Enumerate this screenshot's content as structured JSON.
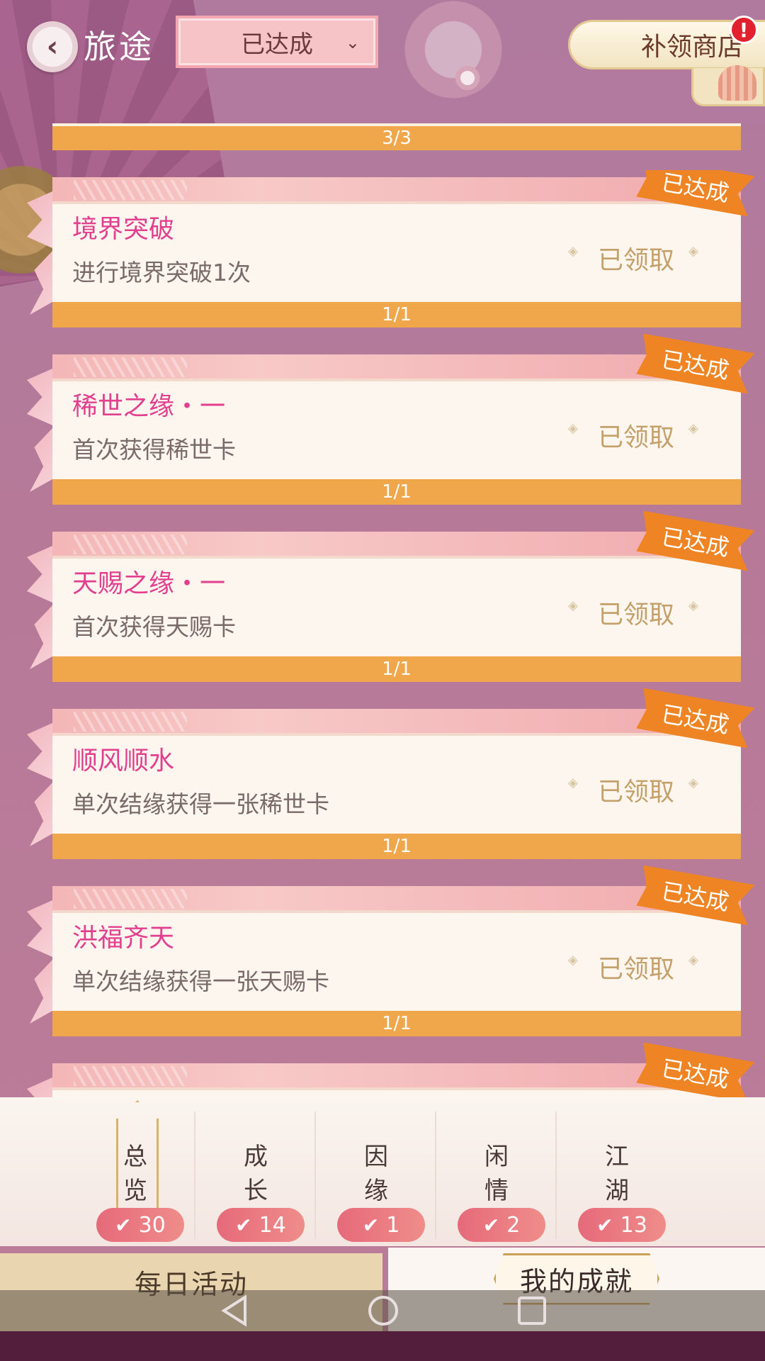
{
  "header": {
    "title": "旅途",
    "filter_selected": "已达成",
    "shop_label": "补领商店",
    "shop_alert": "!"
  },
  "top_progress": "3/3",
  "cards": [
    {
      "name": "境界突破",
      "desc": "进行境界突破1次",
      "status": "已领取",
      "progress": "1/1",
      "tag": "已达成"
    },
    {
      "name": "稀世之缘・一",
      "desc": "首次获得稀世卡",
      "status": "已领取",
      "progress": "1/1",
      "tag": "已达成"
    },
    {
      "name": "天赐之缘・一",
      "desc": "首次获得天赐卡",
      "status": "已领取",
      "progress": "1/1",
      "tag": "已达成"
    },
    {
      "name": "顺风顺水",
      "desc": "单次结缘获得一张稀世卡",
      "status": "已领取",
      "progress": "1/1",
      "tag": "已达成"
    },
    {
      "name": "洪福齐天",
      "desc": "单次结缘获得一张天赐卡",
      "status": "已领取",
      "progress": "1/1",
      "tag": "已达成"
    },
    {
      "name": "",
      "desc": "",
      "status": "",
      "progress": "",
      "tag": "已达成"
    }
  ],
  "categories": [
    {
      "line1": "总",
      "line2": "览",
      "count": "30",
      "selected": true
    },
    {
      "line1": "成",
      "line2": "长",
      "count": "14",
      "selected": false
    },
    {
      "line1": "因",
      "line2": "缘",
      "count": "1",
      "selected": false
    },
    {
      "line1": "闲",
      "line2": "情",
      "count": "2",
      "selected": false
    },
    {
      "line1": "江",
      "line2": "湖",
      "count": "13",
      "selected": false
    }
  ],
  "tabs": {
    "daily": "每日活动",
    "mine": "我的成就"
  },
  "icons": {
    "back": "chevron-left-icon",
    "dropdown": "chevron-down-icon",
    "check": "check-icon",
    "nav_back": "triangle-back-icon",
    "nav_home": "circle-home-icon",
    "nav_recent": "square-recent-icon"
  },
  "colors": {
    "accent_orange": "#f0a64a",
    "tag_orange": "#ee8424",
    "title_pink": "#e2408f",
    "badge_red": "#e66a7a"
  }
}
